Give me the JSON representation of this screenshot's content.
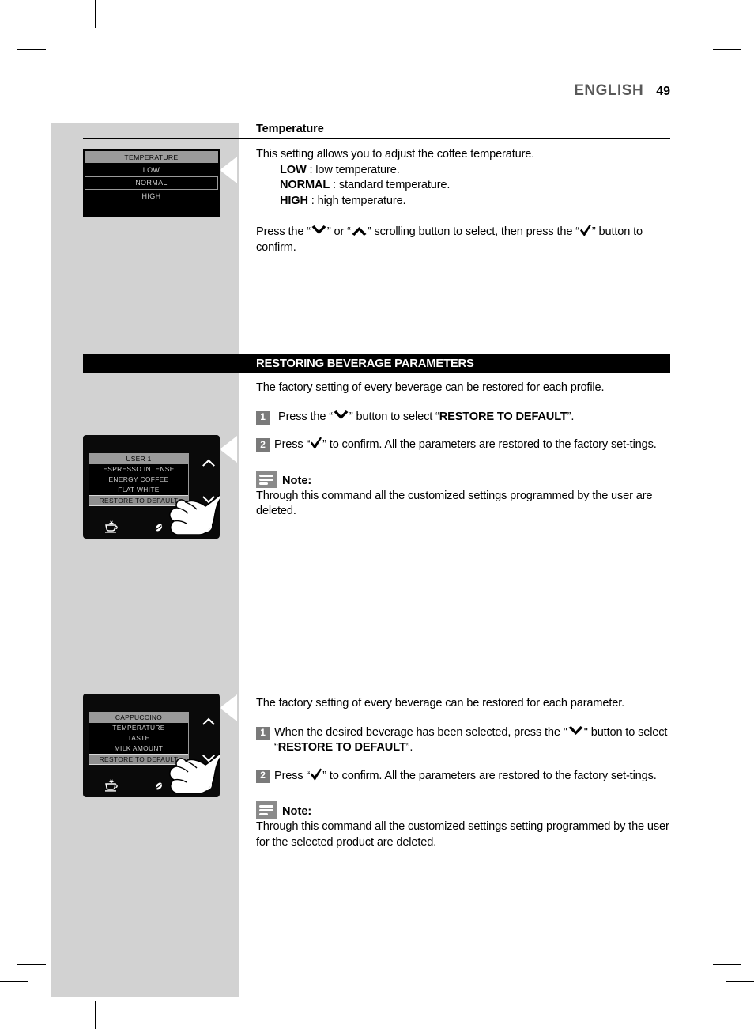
{
  "header": {
    "language": "ENGLISH",
    "page_number": "49"
  },
  "temperature_section": {
    "title": "Temperature",
    "intro": "This setting allows you to adjust the coffee temperature.",
    "options": [
      {
        "term": "LOW",
        "definition": ": low temperature."
      },
      {
        "term": "NORMAL",
        "definition": ": standard temperature."
      },
      {
        "term": "HIGH",
        "definition": ": high temperature."
      }
    ],
    "instruction_parts": {
      "a": "Press the “",
      "b": "” or “",
      "c": "” scrolling button to select, then press the “",
      "d": "” button to confirm."
    },
    "display": {
      "header": "TEMPERATURE",
      "items": [
        "LOW",
        "NORMAL",
        "HIGH"
      ],
      "selected": "NORMAL"
    }
  },
  "restoring_section": {
    "bar_title": "RESTORING BEVERAGE PARAMETERS",
    "profile_intro": "The factory setting of every beverage can be restored for each profile.",
    "profile_steps": [
      {
        "number": "1",
        "a": "Press the “",
        "b": "” button to select “",
        "bold": "RESTORE TO DEFAULT",
        "c": "”."
      },
      {
        "number": "2",
        "a": "Press “",
        "b": "” to confirm. All the parameters are restored to the factory set-tings."
      }
    ],
    "profile_note": {
      "label": "Note:",
      "text": "Through this command all the customized  settings programmed by the user are deleted."
    },
    "profile_display": {
      "header": "USER 1",
      "items": [
        "ESPRESSO INTENSE",
        "ENERGY COFFEE",
        "FLAT WHITE",
        "RESTORE TO DEFAULT"
      ],
      "selected": "RESTORE TO DEFAULT",
      "bottom_icons": [
        "cup-icon",
        "coffee-bean-icon",
        "power-icon"
      ],
      "scroll_icons": [
        "chevron-up-icon",
        "chevron-down-icon"
      ]
    },
    "parameter_intro": "The factory setting of every beverage can be restored for each parameter.",
    "parameter_steps": [
      {
        "number": "1",
        "a": "When the desired beverage has been selected, press the \"",
        "b": "\" button to select “",
        "bold": "RESTORE TO DEFAULT",
        "c": "”."
      },
      {
        "number": "2",
        "a": "Press “",
        "b": "” to confirm. All the parameters are restored to the factory set-tings."
      }
    ],
    "parameter_note": {
      "label": "Note:",
      "text": "Through this command all the customized settings setting programmed by the user for the selected product are deleted."
    },
    "parameter_display": {
      "header": "CAPPUCCINO",
      "items": [
        "TEMPERATURE",
        "TASTE",
        "MILK AMOUNT",
        "RESTORE TO DEFAULT"
      ],
      "selected": "RESTORE TO DEFAULT",
      "bottom_icons": [
        "cup-icon",
        "coffee-bean-icon",
        "power-icon"
      ],
      "scroll_icons": [
        "chevron-up-icon",
        "chevron-down-icon"
      ]
    }
  },
  "colors": {
    "sidebar_gray": "#d2d2d2",
    "bar_black": "#000000",
    "badge_gray": "#7a7a7a",
    "note_icon_gray": "#8a8a8a",
    "display_header_gray": "#9a9a9a"
  }
}
